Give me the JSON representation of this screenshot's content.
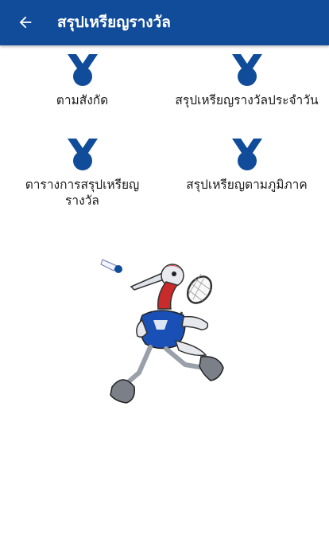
{
  "appbar": {
    "title": "สรุปเหรียญรางวัล",
    "back_icon": "arrow-left-icon",
    "background_color": "#114c9a"
  },
  "menu": {
    "icon": "medal-icon",
    "icon_color": "#114c9a",
    "items": [
      {
        "label": "ตามสังกัด"
      },
      {
        "label": "สรุปเหรียญรางวัลประจำวัน"
      },
      {
        "label": "ตารางการสรุปเหรียญ\nรางวัล"
      },
      {
        "label": "สรุปเหรียญตามภูมิภาค"
      }
    ]
  },
  "mascot": {
    "icon": "bird-badminton-mascot"
  }
}
